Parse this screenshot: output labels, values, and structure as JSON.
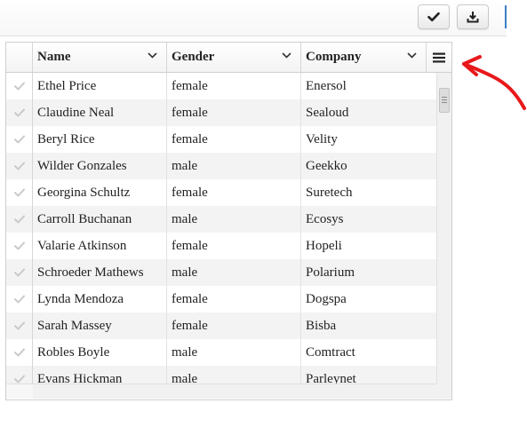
{
  "toolbar": {
    "buttons": [
      {
        "icon": "check-icon"
      },
      {
        "icon": "download-icon"
      }
    ]
  },
  "grid": {
    "columns": [
      {
        "label": "Name"
      },
      {
        "label": "Gender"
      },
      {
        "label": "Company"
      }
    ],
    "rows": [
      {
        "name": "Ethel Price",
        "gender": "female",
        "company": "Enersol"
      },
      {
        "name": "Claudine Neal",
        "gender": "female",
        "company": "Sealoud"
      },
      {
        "name": "Beryl Rice",
        "gender": "female",
        "company": "Velity"
      },
      {
        "name": "Wilder Gonzales",
        "gender": "male",
        "company": "Geekko"
      },
      {
        "name": "Georgina Schultz",
        "gender": "female",
        "company": "Suretech"
      },
      {
        "name": "Carroll Buchanan",
        "gender": "male",
        "company": "Ecosys"
      },
      {
        "name": "Valarie Atkinson",
        "gender": "female",
        "company": "Hopeli"
      },
      {
        "name": "Schroeder Mathews",
        "gender": "male",
        "company": "Polarium"
      },
      {
        "name": "Lynda Mendoza",
        "gender": "female",
        "company": "Dogspa"
      },
      {
        "name": "Sarah Massey",
        "gender": "female",
        "company": "Bisba"
      },
      {
        "name": "Robles Boyle",
        "gender": "male",
        "company": "Comtract"
      },
      {
        "name": "Evans Hickman",
        "gender": "male",
        "company": "Parleynet"
      }
    ],
    "menu_icon": "hamburger-menu-icon"
  },
  "colors": {
    "annotation_arrow": "#e8191b",
    "accent": "#3b7fc4"
  }
}
